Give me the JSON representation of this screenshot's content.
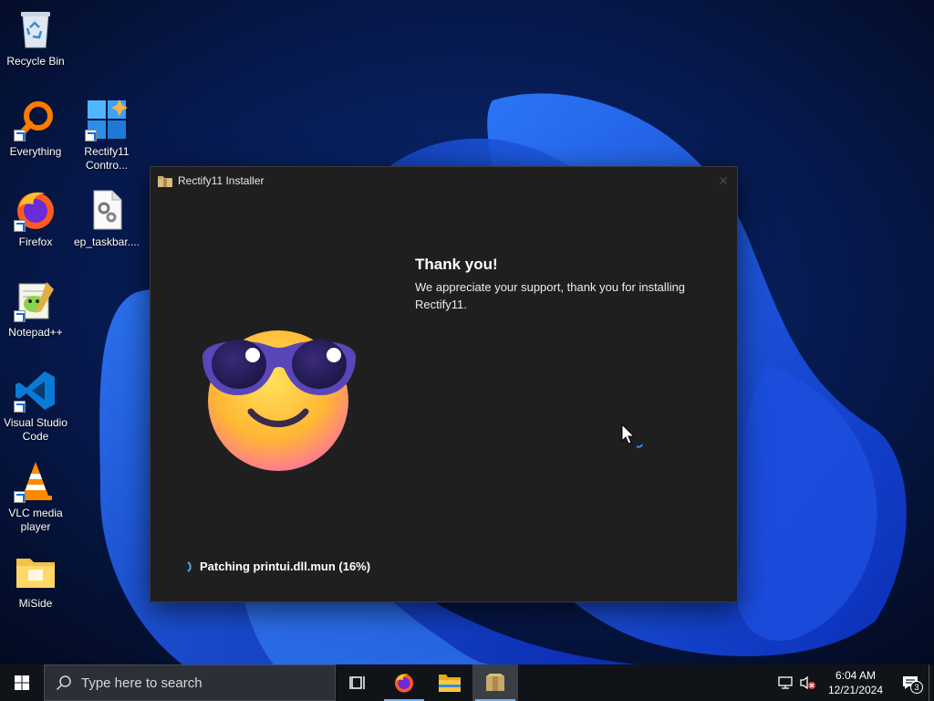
{
  "desktop": {
    "icons": [
      {
        "label": "Recycle Bin",
        "icon": "recycle-bin-icon"
      },
      {
        "label": "Everything",
        "icon": "everything-search-icon"
      },
      {
        "label": "Rectify11 Contro...",
        "icon": "rectify11-control-panel-icon"
      },
      {
        "label": "Firefox",
        "icon": "firefox-icon"
      },
      {
        "label": "ep_taskbar....",
        "icon": "settings-file-icon"
      },
      {
        "label": "Notepad++",
        "icon": "notepad-plus-plus-icon"
      },
      {
        "label": "Visual Studio Code",
        "icon": "vscode-icon"
      },
      {
        "label": "VLC media player",
        "icon": "vlc-icon"
      },
      {
        "label": "MiSide",
        "icon": "folder-icon"
      }
    ]
  },
  "installer": {
    "title": "Rectify11 Installer",
    "heading": "Thank you!",
    "message": "We appreciate your support, thank you for installing Rectify11.",
    "status": "Patching printui.dll.mun (16%)",
    "progress_percent": 16
  },
  "taskbar": {
    "search_placeholder": "Type here to search",
    "apps": [
      "task-view-icon",
      "firefox-icon",
      "file-explorer-icon",
      "installer-icon"
    ],
    "active_app": "installer-icon",
    "time": "6:04 AM",
    "date": "12/21/2024",
    "notification_count": "3"
  },
  "colors": {
    "window_bg": "#1f1f1f",
    "taskbar_bg": "#101418",
    "accent": "#7ab3ea"
  }
}
